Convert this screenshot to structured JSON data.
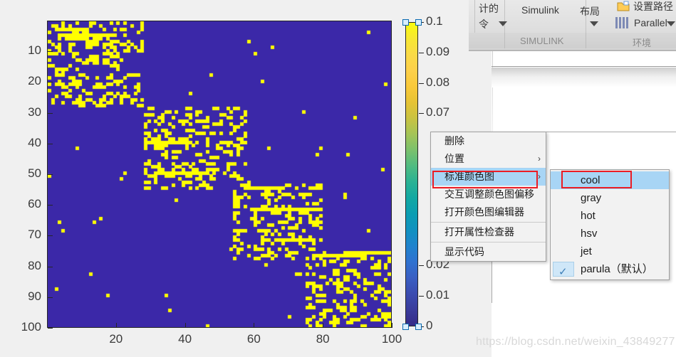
{
  "ribbon": {
    "cut_label_top": "计的",
    "cut_label_bottom": "令",
    "simulink_label": "Simulink",
    "layout_label": "布局",
    "setpath_label": "设置路径",
    "parallel_label": "Parallel",
    "category_simulink": "SIMULINK",
    "category_environment": "环境"
  },
  "figure": {
    "y_ticks": [
      "10",
      "20",
      "30",
      "40",
      "50",
      "60",
      "70",
      "80",
      "90",
      "100"
    ],
    "x_ticks": [
      "20",
      "40",
      "60",
      "80",
      "100"
    ],
    "colorbar_ticks": [
      "0.1",
      "0.09",
      "0.08",
      "0.07",
      "0.02",
      "0.01",
      "0"
    ],
    "colormap_name": "parula",
    "background_color": "#3b28a8",
    "marker_color": "#ffff00"
  },
  "chart_data": {
    "type": "heatmap",
    "title": "",
    "xlabel": "",
    "ylabel": "",
    "xlim": [
      0,
      100
    ],
    "ylim": [
      100,
      0
    ],
    "xticks": [
      20,
      40,
      60,
      80,
      100
    ],
    "yticks": [
      10,
      20,
      30,
      40,
      50,
      60,
      70,
      80,
      90,
      100
    ],
    "grid": false,
    "colormap": "parula",
    "colorbar": {
      "min": 0,
      "max": 0.1,
      "ticks": [
        0,
        0.01,
        0.02,
        0.07,
        0.08,
        0.09,
        0.1
      ],
      "visible_tick_labels": [
        "0.1",
        "0.09",
        "0.08",
        "0.07",
        "0.02",
        "0.01",
        "0"
      ],
      "position": "east",
      "selected": true
    },
    "value_low": 0,
    "value_high": 0.1,
    "description": "Block-diagonal sparse adjacency matrix, 100x100 cells; low values rendered dark blue, high values rendered yellow",
    "blocks": [
      {
        "row_start": 1,
        "row_end": 28,
        "col_start": 1,
        "col_end": 28,
        "density": 0.4
      },
      {
        "row_start": 29,
        "row_end": 55,
        "col_start": 29,
        "col_end": 58,
        "density": 0.38
      },
      {
        "row_start": 54,
        "row_end": 78,
        "col_start": 55,
        "col_end": 80,
        "density": 0.36
      },
      {
        "row_start": 76,
        "row_end": 100,
        "col_start": 76,
        "col_end": 100,
        "density": 0.4
      }
    ],
    "noise_density": 0.006
  },
  "context_menu": {
    "items": [
      {
        "label": "删除",
        "has_submenu": false,
        "selected": false,
        "separator_after": false
      },
      {
        "label": "位置",
        "has_submenu": true,
        "selected": false,
        "separator_after": false
      },
      {
        "label": "标准颜色图",
        "has_submenu": true,
        "selected": true,
        "separator_after": false
      },
      {
        "label": "交互调整颜色图偏移",
        "has_submenu": false,
        "selected": false,
        "separator_after": false
      },
      {
        "label": "打开颜色图编辑器",
        "has_submenu": false,
        "selected": false,
        "separator_after": true
      },
      {
        "label": "打开属性检查器",
        "has_submenu": false,
        "selected": false,
        "separator_after": true
      },
      {
        "label": "显示代码",
        "has_submenu": false,
        "selected": false,
        "separator_after": false
      }
    ]
  },
  "submenu": {
    "items": [
      {
        "label": "cool",
        "checked": false,
        "selected": true
      },
      {
        "label": "gray",
        "checked": false,
        "selected": false
      },
      {
        "label": "hot",
        "checked": false,
        "selected": false
      },
      {
        "label": "hsv",
        "checked": false,
        "selected": false
      },
      {
        "label": "jet",
        "checked": false,
        "selected": false
      },
      {
        "label": "parula（默认）",
        "checked": true,
        "selected": false
      }
    ],
    "check_glyph": "✓"
  },
  "watermark": {
    "text": "https://blog.csdn.net/weixin_43849277"
  },
  "colors": {
    "highlight": "#a8d5f5",
    "annotation_red": "#ec1c24",
    "axis": "#262626"
  }
}
